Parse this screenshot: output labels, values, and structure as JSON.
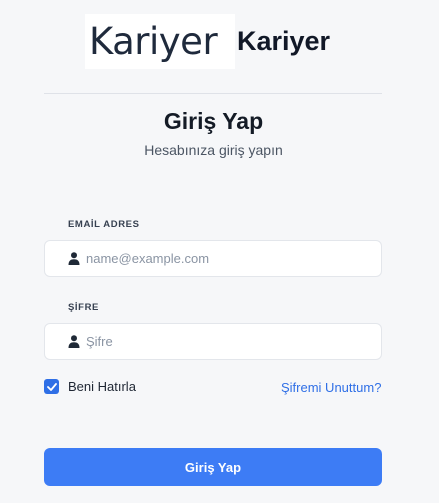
{
  "brand": {
    "logo_text": "Kariyer",
    "name": "Kariyer"
  },
  "login": {
    "title": "Giriş Yap",
    "subtitle": "Hesabınıza giriş yapın",
    "email": {
      "label": "EMAİL ADRES",
      "placeholder": "name@example.com",
      "value": "",
      "icon": "user-icon"
    },
    "password": {
      "label": "ŞİFRE",
      "placeholder": "Şifre",
      "value": "",
      "icon": "user-icon"
    },
    "remember_me": {
      "label": "Beni Hatırla",
      "checked": true
    },
    "forgot_password": "Şifremi Unuttum?",
    "submit_label": "Giriş Yap"
  },
  "colors": {
    "accent": "#3d7cf5",
    "link": "#2f6fe6",
    "background": "#f6f7f9"
  }
}
